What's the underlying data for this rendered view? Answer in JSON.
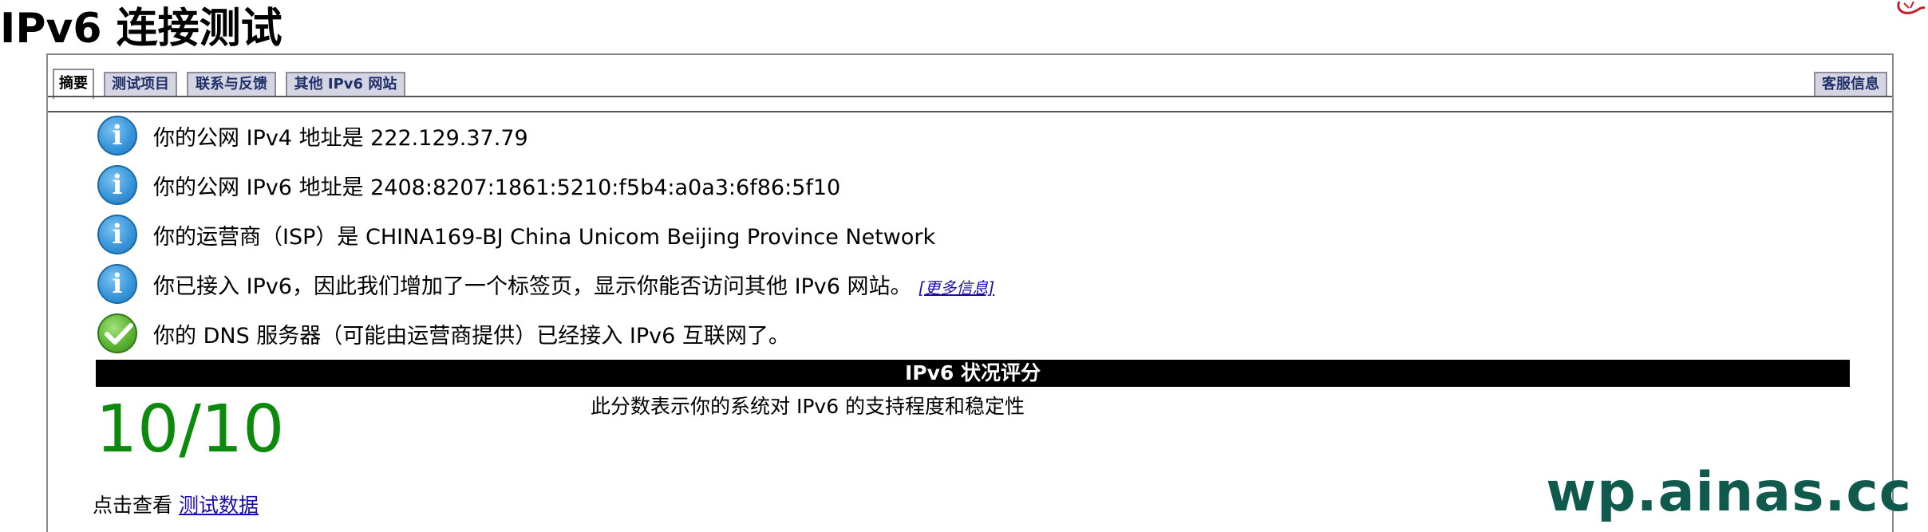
{
  "page": {
    "title": "IPv6 连接测试"
  },
  "tabs": [
    {
      "label": "摘要",
      "active": true
    },
    {
      "label": "测试项目",
      "active": false
    },
    {
      "label": "联系与反馈",
      "active": false
    },
    {
      "label": "其他 IPv6 网站",
      "active": false
    },
    {
      "label": "客服信息",
      "active": false
    }
  ],
  "messages": [
    {
      "icon": "info-icon",
      "text": "你的公网 IPv4 地址是 222.129.37.79"
    },
    {
      "icon": "info-icon",
      "text": "你的公网 IPv6 地址是 2408:8207:1861:5210:f5b4:a0a3:6f86:5f10"
    },
    {
      "icon": "info-icon",
      "text": "你的运营商（ISP）是 CHINA169-BJ China Unicom Beijing Province Network"
    },
    {
      "icon": "info-icon",
      "text": "你已接入 IPv6，因此我们增加了一个标签页，显示你能否访问其他 IPv6 网站。",
      "link": "[更多信息]"
    },
    {
      "icon": "checkmark-icon",
      "text": "你的 DNS 服务器（可能由运营商提供）已经接入 IPv6 互联网了。"
    }
  ],
  "score_section": {
    "header": "IPv6 状况评分",
    "score": "10/10",
    "description": "此分数表示你的系统对 IPv6 的支持程度和稳定性"
  },
  "footer": {
    "prefix": "点击查看",
    "link": "测试数据"
  },
  "watermark": "wp.ainas.cc",
  "colors": {
    "score": "#0c8a0c",
    "tab_bg": "#d4d4e2",
    "tab_text": "#1f3068",
    "link": "#1a0dab",
    "watermark": "#0f5a4d"
  }
}
